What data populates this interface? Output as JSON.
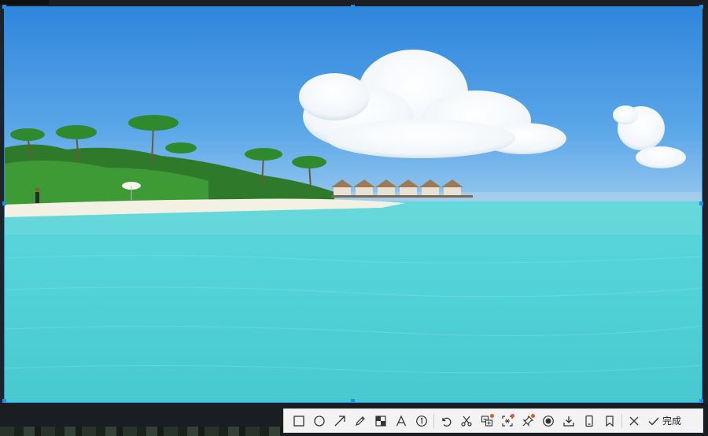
{
  "toolbar": {
    "tools": [
      {
        "name": "rectangle-tool",
        "icon": "rectangle-icon"
      },
      {
        "name": "ellipse-tool",
        "icon": "circle-icon"
      },
      {
        "name": "arrow-tool",
        "icon": "arrow-icon"
      },
      {
        "name": "pen-tool",
        "icon": "pencil-icon"
      },
      {
        "name": "mosaic-tool",
        "icon": "mosaic-icon"
      },
      {
        "name": "text-tool",
        "icon": "text-icon"
      },
      {
        "name": "number-marker-tool",
        "icon": "number-circle-icon"
      },
      {
        "name": "undo-button",
        "icon": "undo-icon"
      },
      {
        "name": "scissors-button",
        "icon": "scissors-icon"
      },
      {
        "name": "translate-button",
        "icon": "translate-icon",
        "badge": true
      },
      {
        "name": "ocr-button",
        "icon": "scan-icon",
        "badge": true
      },
      {
        "name": "pin-button",
        "icon": "pin-icon",
        "badge": true
      },
      {
        "name": "record-button",
        "icon": "record-icon"
      },
      {
        "name": "download-button",
        "icon": "download-icon"
      },
      {
        "name": "phone-button",
        "icon": "phone-icon"
      },
      {
        "name": "bookmark-button",
        "icon": "bookmark-icon"
      },
      {
        "name": "close-button",
        "icon": "close-icon"
      }
    ],
    "done_label": "完成"
  },
  "colors": {
    "selection": "#1e8fe8",
    "badge": "#e8562a"
  }
}
